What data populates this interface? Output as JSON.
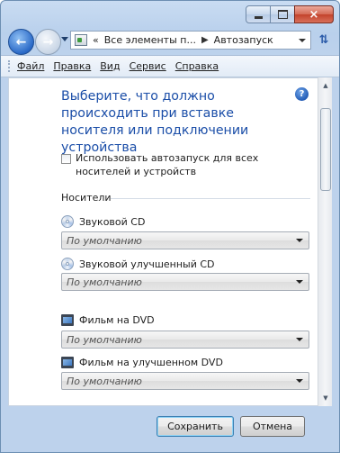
{
  "window": {
    "caption": {
      "minimize": "minimize",
      "maximize": "maximize",
      "close": "×"
    }
  },
  "address": {
    "prefix": "«",
    "crumbs": [
      "Все элементы п...",
      "Автозапуск"
    ],
    "separator": "▶"
  },
  "menu": {
    "items": [
      {
        "label": "Файл"
      },
      {
        "label": "Правка"
      },
      {
        "label": "Вид"
      },
      {
        "label": "Сервис"
      },
      {
        "label": "Справка"
      }
    ]
  },
  "content": {
    "title": "Выберите, что должно происходить при вставке носителя или подключении устройства",
    "help_glyph": "?",
    "autorun_checkbox": {
      "label": "Использовать автозапуск для всех носителей и устройств",
      "checked": false
    },
    "group_heading": "Носители",
    "media": [
      {
        "name": "Звуковой CD",
        "icon": "audio-cd-icon",
        "value": "По умолчанию"
      },
      {
        "name": "Звуковой улучшенный CD",
        "icon": "enhanced-audio-cd-icon",
        "value": "По умолчанию"
      },
      {
        "name": "Фильм на DVD",
        "icon": "dvd-movie-icon",
        "value": "По умолчанию"
      },
      {
        "name": "Фильм на улучшенном DVD",
        "icon": "enhanced-dvd-movie-icon",
        "value": "По умолчанию"
      }
    ]
  },
  "buttons": {
    "save": "Сохранить",
    "cancel": "Отмена"
  },
  "colors": {
    "title_blue": "#1b4ea8",
    "chrome_blue": "#b9d0ec",
    "close_red": "#c3422b"
  }
}
